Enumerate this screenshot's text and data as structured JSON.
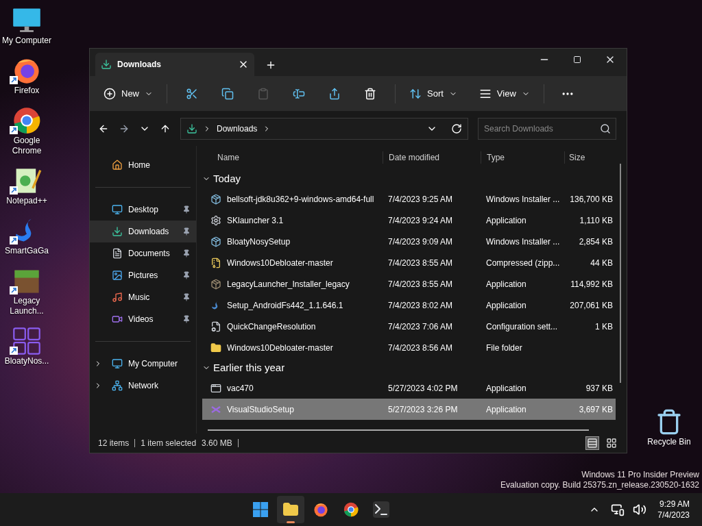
{
  "desktop_icons": [
    {
      "label": "My Computer",
      "kind": "computer",
      "shortcut": false
    },
    {
      "label": "Firefox",
      "kind": "firefox",
      "shortcut": true
    },
    {
      "label": "Google Chrome",
      "kind": "chrome",
      "shortcut": true
    },
    {
      "label": "Notepad++",
      "kind": "notepad",
      "shortcut": true
    },
    {
      "label": "SmartGaGa",
      "kind": "swan",
      "shortcut": true
    },
    {
      "label": "Legacy Launch...",
      "kind": "block",
      "shortcut": true
    },
    {
      "label": "BloatyNos...",
      "kind": "grid",
      "shortcut": true
    }
  ],
  "recycle_bin": {
    "label": "Recycle Bin"
  },
  "explorer": {
    "tab": {
      "title": "Downloads"
    },
    "toolbar": {
      "new": "New",
      "sort": "Sort",
      "view": "View"
    },
    "address": {
      "crumb": "Downloads"
    },
    "search": {
      "placeholder": "Search Downloads"
    },
    "sidebar": [
      {
        "items": [
          {
            "label": "Home",
            "kind": "home",
            "pinned": false,
            "selected": false,
            "expandable": false
          }
        ]
      },
      {
        "items": [
          {
            "label": "Desktop",
            "kind": "desktop",
            "pinned": true,
            "selected": false,
            "expandable": false
          },
          {
            "label": "Downloads",
            "kind": "download",
            "pinned": true,
            "selected": true,
            "expandable": false
          },
          {
            "label": "Documents",
            "kind": "document",
            "pinned": true,
            "selected": false,
            "expandable": false
          },
          {
            "label": "Pictures",
            "kind": "picture",
            "pinned": true,
            "selected": false,
            "expandable": false
          },
          {
            "label": "Music",
            "kind": "music",
            "pinned": true,
            "selected": false,
            "expandable": false
          },
          {
            "label": "Videos",
            "kind": "video",
            "pinned": true,
            "selected": false,
            "expandable": false
          }
        ]
      },
      {
        "items": [
          {
            "label": "My Computer",
            "kind": "computer",
            "pinned": false,
            "selected": false,
            "expandable": true
          },
          {
            "label": "Network",
            "kind": "network",
            "pinned": false,
            "selected": false,
            "expandable": true
          }
        ]
      }
    ],
    "columns": [
      "Name",
      "Date modified",
      "Type",
      "Size"
    ],
    "groups": [
      {
        "title": "Today",
        "expanded": true,
        "files": [
          {
            "name": "bellsoft-jdk8u362+9-windows-amd64-full",
            "date": "7/4/2023 9:25 AM",
            "type": "Windows Installer ...",
            "size": "136,700 KB",
            "kind": "installer",
            "selected": false
          },
          {
            "name": "SKlauncher 3.1",
            "date": "7/4/2023 9:24 AM",
            "type": "Application",
            "size": "1,110 KB",
            "kind": "gear",
            "selected": false
          },
          {
            "name": "BloatyNosySetup",
            "date": "7/4/2023 9:09 AM",
            "type": "Windows Installer ...",
            "size": "2,854 KB",
            "kind": "installer",
            "selected": false
          },
          {
            "name": "Windows10Debloater-master",
            "date": "7/4/2023 8:55 AM",
            "type": "Compressed (zipp...",
            "size": "44 KB",
            "kind": "zip",
            "selected": false
          },
          {
            "name": "LegacyLauncher_Installer_legacy",
            "date": "7/4/2023 8:55 AM",
            "type": "Application",
            "size": "114,992 KB",
            "kind": "block",
            "selected": false
          },
          {
            "name": "Setup_AndroidFs442_1.1.646.1",
            "date": "7/4/2023 8:02 AM",
            "type": "Application",
            "size": "207,061 KB",
            "kind": "swan",
            "selected": false
          },
          {
            "name": "QuickChangeResolution",
            "date": "7/4/2023 7:06 AM",
            "type": "Configuration sett...",
            "size": "1 KB",
            "kind": "config",
            "selected": false
          },
          {
            "name": "Windows10Debloater-master",
            "date": "7/4/2023 8:56 AM",
            "type": "File folder",
            "kind": "folder",
            "selected": false
          }
        ]
      },
      {
        "title": "Earlier this year",
        "expanded": true,
        "files": [
          {
            "name": "vac470",
            "date": "5/27/2023 4:02 PM",
            "type": "Application",
            "size": "937 KB",
            "kind": "app",
            "selected": false
          },
          {
            "name": "VisualStudioSetup",
            "date": "5/27/2023 3:26 PM",
            "type": "Application",
            "size": "3,697 KB",
            "kind": "vs",
            "selected": true
          }
        ]
      }
    ],
    "status": {
      "count": "12 items",
      "selection": "1 item selected",
      "size": "3.60 MB"
    },
    "views": [
      {
        "kind": "details",
        "selected": true
      },
      {
        "kind": "tiles",
        "selected": false
      }
    ]
  },
  "watermark": [
    "Windows 11 Pro Insider Preview",
    "Evaluation copy. Build 25375.zn_release.230520-1632"
  ],
  "taskbar": {
    "apps": [
      {
        "kind": "start",
        "active": false
      },
      {
        "kind": "explorer",
        "active": true
      },
      {
        "kind": "firefox",
        "active": false
      },
      {
        "kind": "chrome",
        "active": false
      },
      {
        "kind": "terminal",
        "active": false
      }
    ],
    "time": "9:29 AM",
    "date": "7/4/2023"
  }
}
